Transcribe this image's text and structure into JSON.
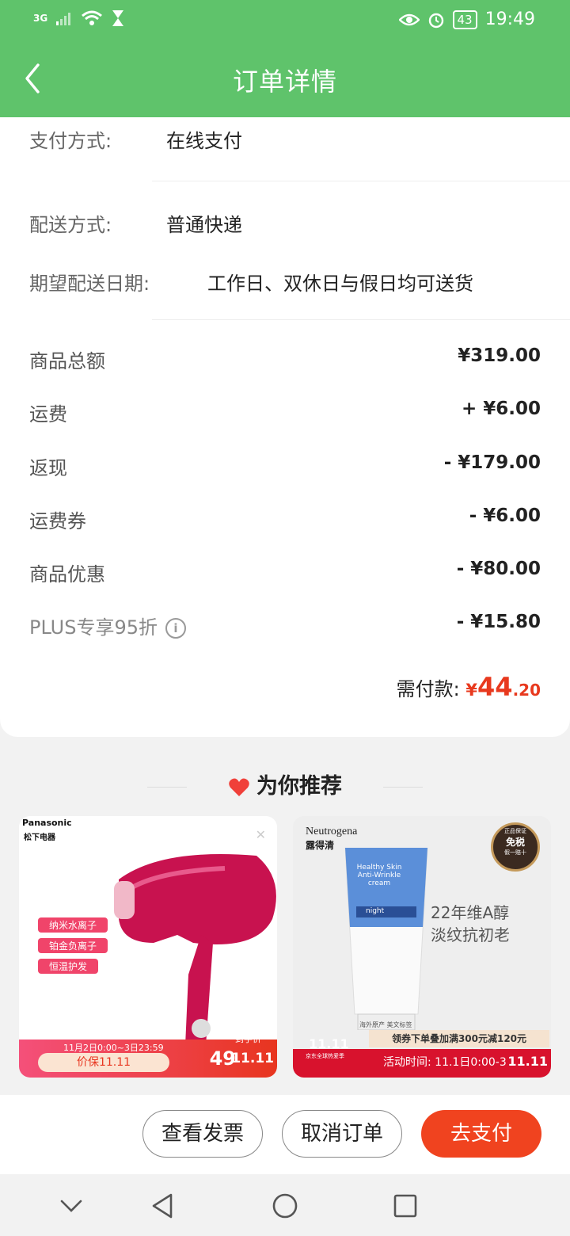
{
  "status_bar": {
    "network": "3G",
    "battery": "43",
    "time": "19:49"
  },
  "header": {
    "title": "订单详情"
  },
  "order_info": {
    "payment_label": "支付方式:",
    "payment_value": "在线支付",
    "delivery_label": "配送方式:",
    "delivery_value": "普通快递",
    "date_label": "期望配送日期:",
    "date_value": "工作日、双休日与假日均可送货"
  },
  "amounts": [
    {
      "label": "商品总额",
      "value": "¥319.00"
    },
    {
      "label": "运费",
      "value": "+ ¥6.00"
    },
    {
      "label": "返现",
      "value": "- ¥179.00"
    },
    {
      "label": "运费券",
      "value": "- ¥6.00"
    },
    {
      "label": "商品优惠",
      "value": "- ¥80.00"
    },
    {
      "label": "PLUS专享95折",
      "value": "- ¥15.80"
    }
  ],
  "total": {
    "label": "需付款:",
    "currency": "¥",
    "integer": "44",
    "decimal": ".20"
  },
  "recommend": {
    "title": "为你推荐",
    "products": [
      {
        "brand": "Panasonic",
        "brand_cn": "松下电器",
        "tags": [
          "纳米水离子",
          "铂金负离子",
          "恒温护发"
        ],
        "promo_date": "11月2日0:00~3日23:59",
        "promo_text": "价保11.11",
        "badge": "到手价",
        "badge_price": "49",
        "event_logo": "11.11"
      },
      {
        "brand": "Neutrogena",
        "brand_cn": "露得清",
        "tube_text": "Healthy Skin Anti-Wrinkle cream",
        "tube_night": "night",
        "badge_top": "正品保证",
        "badge_center": "免税",
        "badge_bottom": "假一赔十",
        "headline_1": "22年维A醇",
        "headline_2": "淡纹抗初老",
        "coupon_text": "领券下单叠加满300元减120元",
        "activity_text": "活动时间: 11.1日0:00-3",
        "event_logo": "11.11",
        "event_sub": "京东全球热爱季",
        "origin_note": "海外原产 美文标签"
      }
    ]
  },
  "actions": {
    "invoice": "查看发票",
    "cancel": "取消订单",
    "pay": "去支付"
  },
  "colors": {
    "header_green": "#5fc36b",
    "accent_red": "#f0431f"
  }
}
